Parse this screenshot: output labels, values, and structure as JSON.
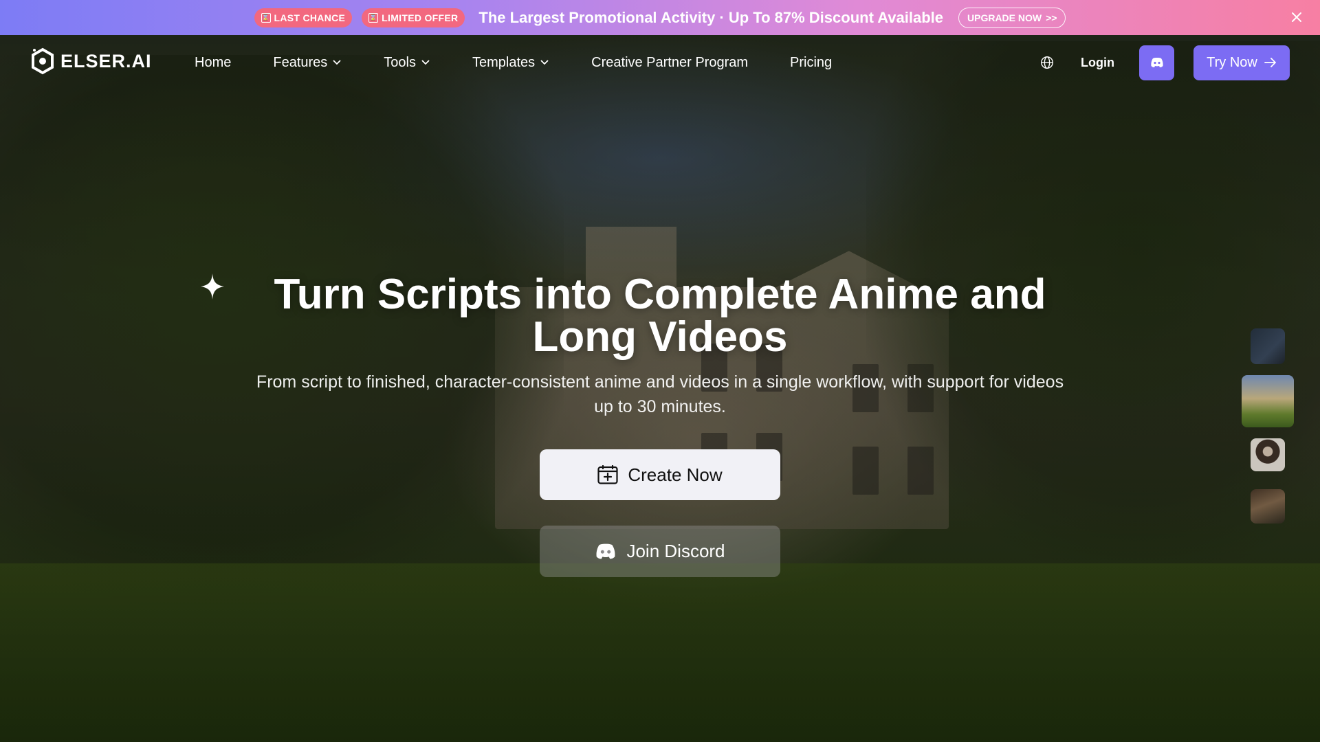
{
  "promo": {
    "badge_last_chance": "LAST CHANCE",
    "badge_limited_offer": "LIMITED OFFER",
    "message": "The Largest Promotional Activity · Up To 87% Discount Available",
    "upgrade_label": "UPGRADE NOW",
    "upgrade_arrows": ">>"
  },
  "brand": {
    "name": "ELSER.AI"
  },
  "nav": {
    "items": [
      {
        "label": "Home",
        "has_dropdown": false
      },
      {
        "label": "Features",
        "has_dropdown": true
      },
      {
        "label": "Tools",
        "has_dropdown": true
      },
      {
        "label": "Templates",
        "has_dropdown": true
      },
      {
        "label": "Creative Partner Program",
        "has_dropdown": false
      },
      {
        "label": "Pricing",
        "has_dropdown": false
      }
    ],
    "login": "Login",
    "try_now": "Try Now"
  },
  "hero": {
    "title_line1": "Turn Scripts into Complete Anime and",
    "title_line2": "Long Videos",
    "subtitle_line1": "From script to finished, character-consistent anime and videos in a single workflow, with support for videos",
    "subtitle_line2": "up to 30 minutes.",
    "create_now": "Create Now",
    "join_discord": "Join Discord"
  },
  "colors": {
    "accent": "#7c6cf3",
    "promo_start": "#7d7cf5",
    "promo_end": "#f77fa3",
    "badge": "#f2687f",
    "create_button_bg": "#f1f1f6"
  },
  "icons": {
    "logo": "hexagon-logo-icon",
    "globe": "globe-icon",
    "discord": "discord-icon",
    "arrow": "arrow-right-icon",
    "sparkle": "sparkle-icon",
    "create": "calendar-plus-icon",
    "close": "close-icon"
  }
}
